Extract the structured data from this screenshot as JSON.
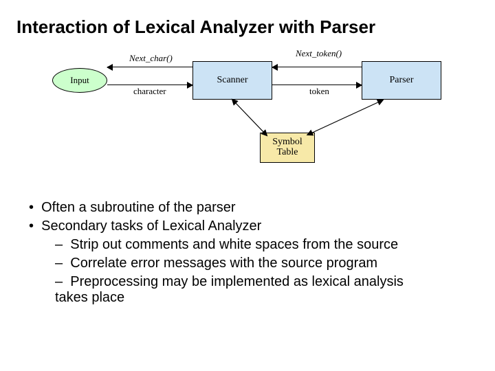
{
  "title": "Interaction of Lexical Analyzer with Parser",
  "diagram": {
    "input": "Input",
    "scanner": "Scanner",
    "parser": "Parser",
    "symbol_table_l1": "Symbol",
    "symbol_table_l2": "Table",
    "next_char": "Next_char()",
    "character": "character",
    "next_token": "Next_token()",
    "token": "token"
  },
  "bullets": {
    "b1": "Often a subroutine of the parser",
    "b2": "Secondary tasks of Lexical Analyzer",
    "s1": "Strip out comments and white spaces from the source",
    "s2": "Correlate error messages with the source program",
    "s3": "Preprocessing may be implemented as lexical analysis takes place"
  }
}
